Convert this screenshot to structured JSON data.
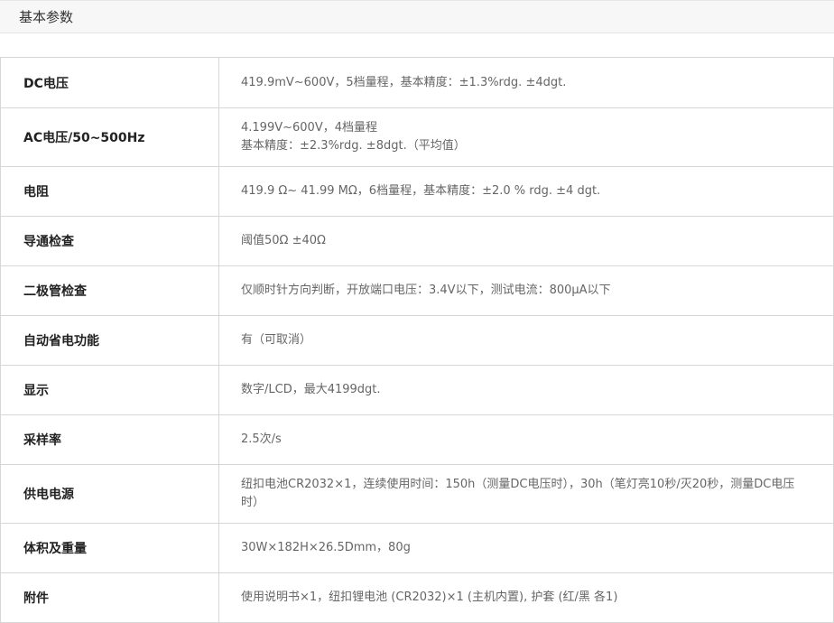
{
  "section": {
    "title": "基本参数"
  },
  "specs": [
    {
      "label": "DC电压",
      "lines": [
        "419.9mV~600V，5档量程，基本精度：±1.3%rdg. ±4dgt."
      ]
    },
    {
      "label": "AC电压/50~500Hz",
      "lines": [
        "4.199V~600V，4档量程",
        "基本精度：±2.3%rdg. ±8dgt.（平均值）"
      ]
    },
    {
      "label": "电阻",
      "lines": [
        "419.9 Ω~ 41.99 MΩ，6档量程，基本精度：±2.0 % rdg. ±4 dgt."
      ]
    },
    {
      "label": "导通检查",
      "lines": [
        "阈值50Ω ±40Ω"
      ]
    },
    {
      "label": "二极管检查",
      "lines": [
        "仅顺时针方向判断，开放端口电压：3.4V以下，测试电流：800μA以下"
      ]
    },
    {
      "label": "自动省电功能",
      "lines": [
        "有（可取消）"
      ]
    },
    {
      "label": "显示",
      "lines": [
        "数字/LCD，最大4199dgt."
      ]
    },
    {
      "label": "采样率",
      "lines": [
        "2.5次/s"
      ]
    },
    {
      "label": "供电电源",
      "lines": [
        "纽扣电池CR2032×1，连续使用时间：150h（测量DC电压时），30h（笔灯亮10秒/灭20秒，测量DC电压",
        "时）"
      ]
    },
    {
      "label": "体积及重量",
      "lines": [
        "30W×182H×26.5Dmm，80g"
      ]
    },
    {
      "label": "附件",
      "lines": [
        "使用说明书×1，纽扣锂电池 (CR2032)×1 (主机内置), 护套 (红/黑 各1)"
      ]
    }
  ]
}
